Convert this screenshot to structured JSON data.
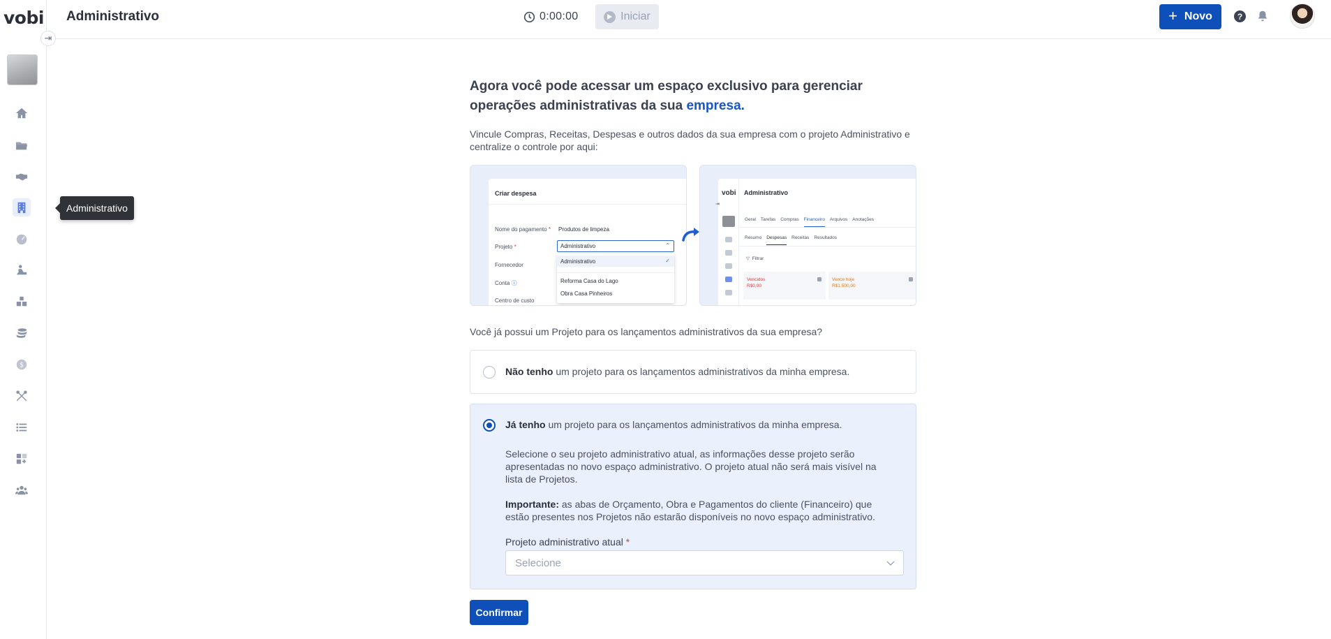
{
  "brand": {
    "logo": "vobi",
    "accent": "#0f4fba",
    "link": "#1756c9"
  },
  "sidebar": {
    "tooltip": "Administrativo",
    "items": [
      {
        "icon": "home-icon"
      },
      {
        "icon": "folder-icon"
      },
      {
        "icon": "handshake-icon"
      },
      {
        "icon": "building-icon",
        "active": true
      },
      {
        "icon": "gauge-icon"
      },
      {
        "icon": "worker-icon"
      },
      {
        "icon": "boxes-icon"
      },
      {
        "icon": "coins-icon"
      },
      {
        "icon": "dollar-icon"
      },
      {
        "icon": "tools-icon"
      },
      {
        "icon": "list-icon"
      },
      {
        "icon": "apps-add-icon"
      },
      {
        "icon": "team-icon"
      }
    ]
  },
  "header": {
    "title": "Administrativo",
    "timer": "0:00:00",
    "start_label": "Iniciar",
    "new_label": "Novo"
  },
  "main": {
    "headline_part1": "Agora você pode acessar um espaço exclusivo para gerenciar operações administrativas da sua ",
    "headline_accent": "empresa.",
    "lead": "Vincule Compras, Receitas, Despesas e outros dados da sua empresa com o projeto Administrativo e centralize o controle por aqui:",
    "preview_form": {
      "title": "Criar despesa",
      "fields": [
        {
          "label": "Nome do pagamento",
          "required": "*",
          "value": "Produtos de limpeza"
        },
        {
          "label": "Projeto",
          "required": "*",
          "value": "Administrativo"
        },
        {
          "label": "Fornecedor"
        },
        {
          "label": "Conta"
        },
        {
          "label": "Centro de custo"
        }
      ],
      "options": [
        "Administrativo",
        "Reforma Casa do Lago",
        "Obra Casa Pinheiros"
      ]
    },
    "preview_app": {
      "logo": "vobi",
      "title": "Administrativo",
      "tabs": [
        "Geral",
        "Tarefas",
        "Compras",
        "Financeiro",
        "Arquivos",
        "Anotações"
      ],
      "subtabs": [
        "Resumo",
        "Despesas",
        "Receitas",
        "Resultados"
      ],
      "filter": "Filtrar",
      "cards": [
        {
          "label": "Vencidos",
          "value": "R$0,00",
          "color": "#e03b3b"
        },
        {
          "label": "Vence hoje",
          "value": "R$1.500,00",
          "color": "#e07a17"
        }
      ]
    },
    "question": "Você já possui um Projeto para os lançamentos administrativos da sua empresa?",
    "option_no": {
      "bold": "Não tenho",
      "text": " um projeto para os lançamentos administrativos da minha empresa."
    },
    "option_yes": {
      "bold": "Já tenho",
      "text": " um projeto para os lançamentos administrativos da minha empresa.",
      "desc": "Selecione o seu projeto administrativo atual, as informações desse projeto serão apresentadas no novo espaço administrativo. O projeto atual não será mais visível na lista de Projetos.",
      "important_bold": "Importante:",
      "important_text": " as abas de Orçamento, Obra e Pagamentos do cliente (Financeiro) que estão presentes nos Projetos não estarão disponíveis no novo espaço administrativo.",
      "field_label": "Projeto administrativo atual",
      "field_required": "*",
      "field_placeholder": "Selecione"
    },
    "confirm_label": "Confirmar"
  }
}
